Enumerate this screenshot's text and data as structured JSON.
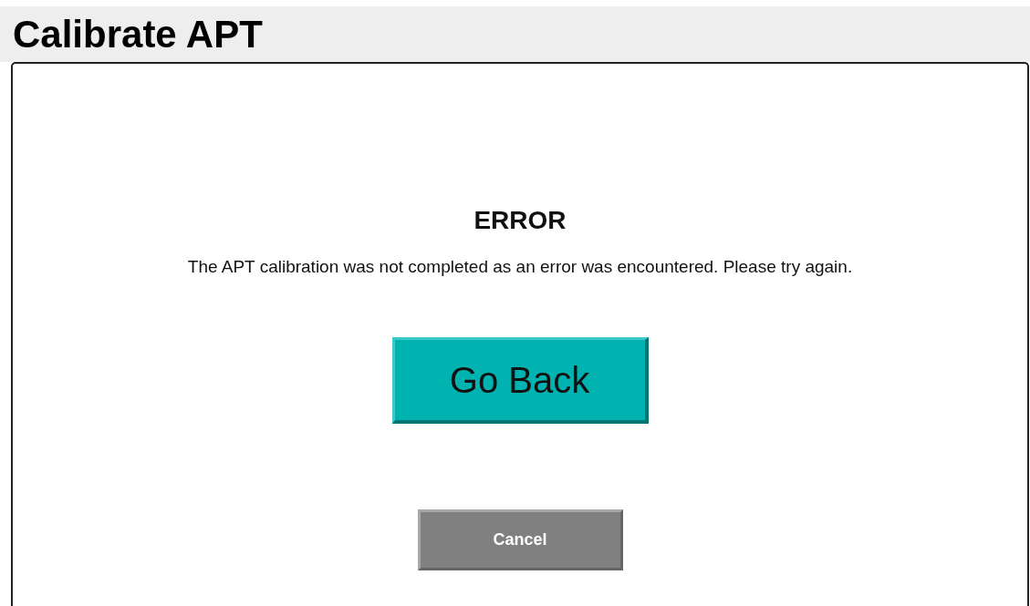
{
  "header": {
    "title": "Calibrate APT"
  },
  "dialog": {
    "heading": "ERROR",
    "message": "The APT calibration was not completed as an error was encountered. Please try again."
  },
  "buttons": [
    {
      "label": "Go Back",
      "kind": "primary"
    },
    {
      "label": "Cancel",
      "kind": "secondary"
    }
  ]
}
